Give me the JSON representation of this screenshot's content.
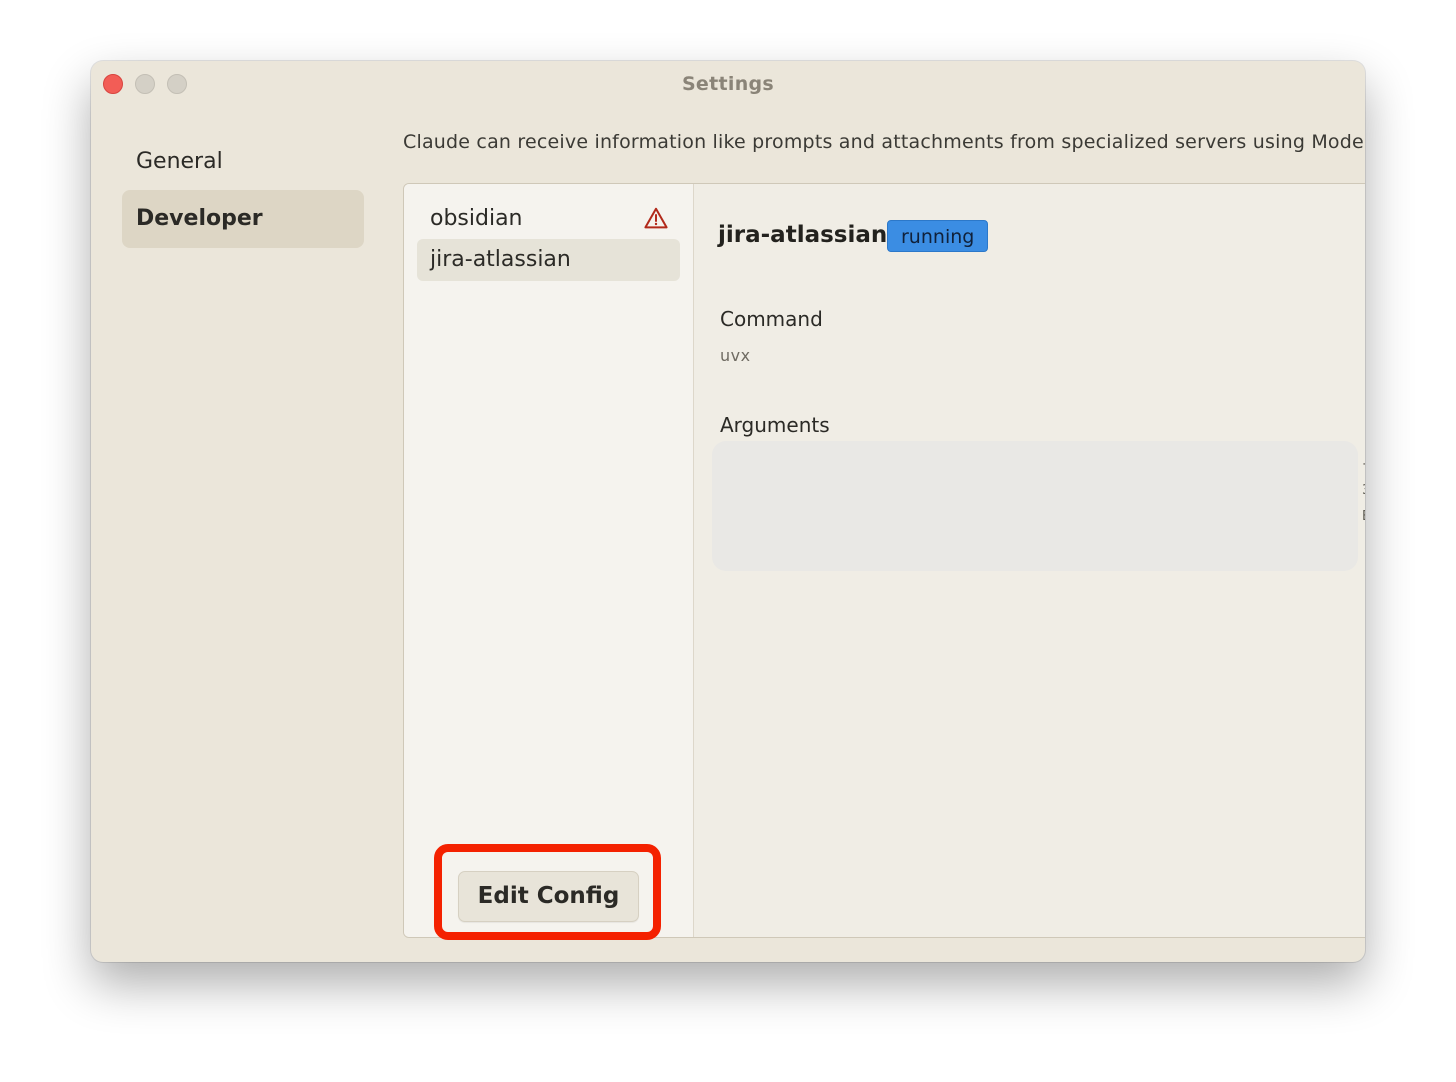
{
  "window": {
    "title": "Settings"
  },
  "sidebar": {
    "items": [
      {
        "label": "General",
        "selected": false
      },
      {
        "label": "Developer",
        "selected": true
      }
    ]
  },
  "description": "Claude can receive information like prompts and attachments from specialized servers using Model C",
  "servers": {
    "items": [
      {
        "name": "obsidian",
        "icon": "warning-triangle-icon",
        "selected": false
      },
      {
        "name": "jira-atlassian",
        "selected": true
      }
    ],
    "edit_button_label": "Edit Config"
  },
  "detail": {
    "server_name": "jira-atlassian",
    "status": "running",
    "command_label": "Command",
    "command_value": "uvx",
    "arguments_label": "Arguments",
    "arguments_value": ""
  },
  "colors": {
    "window_bg": "#ebe6da",
    "status_badge": "#3b8de3",
    "close_button": "#f25d56",
    "warning_icon": "#b22a1b",
    "highlight_annotation": "#f42100"
  }
}
